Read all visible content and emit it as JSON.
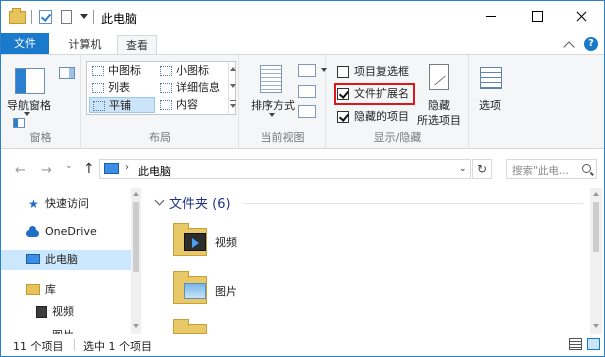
{
  "window": {
    "title": "此电脑"
  },
  "ribbon_tabs": [
    {
      "label": "文件"
    },
    {
      "label": "计算机"
    },
    {
      "label": "查看"
    }
  ],
  "help": {
    "glyph": "?"
  },
  "panes_group": {
    "nav_pane_label": "导航窗格",
    "group_label": "窗格"
  },
  "layout_group": {
    "items": [
      {
        "label": "中图标"
      },
      {
        "label": "小图标"
      },
      {
        "label": "列表"
      },
      {
        "label": "详细信息"
      },
      {
        "label": "平铺",
        "selected": true
      },
      {
        "label": "内容"
      }
    ],
    "group_label": "布局"
  },
  "view_group": {
    "sort_label": "排序方式",
    "group_label": "当前视图"
  },
  "showhide_group": {
    "checkboxes": [
      {
        "label": "项目复选框",
        "checked": false
      },
      {
        "label": "文件扩展名",
        "checked": true
      },
      {
        "label": "隐藏的项目",
        "checked": true
      }
    ],
    "hide_label": "隐藏",
    "hide_sub_label": "所选项目",
    "group_label": "显示/隐藏"
  },
  "options_group": {
    "label": "选项"
  },
  "address": {
    "back": "←",
    "forward": "→",
    "history": "⌄",
    "up": "↑",
    "chevron": "›",
    "path": "此电脑",
    "dropdown": "⌄",
    "refresh": "↻",
    "search_placeholder": "搜索\"此电..."
  },
  "nav_pane": {
    "items": [
      {
        "label": "快速访问",
        "icon": "star-icon"
      },
      {
        "label": "OneDrive",
        "icon": "cloud-icon"
      },
      {
        "label": "此电脑",
        "icon": "pc-icon",
        "selected": true
      },
      {
        "label": "库",
        "icon": "library-icon"
      },
      {
        "label": "视频",
        "icon": "video-icon"
      },
      {
        "label": "图片",
        "icon": "picture-icon"
      }
    ]
  },
  "content": {
    "section_title": "文件夹 (6)",
    "items": [
      {
        "label": "视频",
        "icon": "video-folder-icon"
      },
      {
        "label": "图片",
        "icon": "picture-folder-icon"
      }
    ]
  },
  "status": {
    "count": "11 个项目",
    "selected": "选中 1 个项目"
  },
  "colors": {
    "accent": "#1979ca",
    "highlight_box": "#e0161b",
    "selection": "#cce8ff"
  }
}
